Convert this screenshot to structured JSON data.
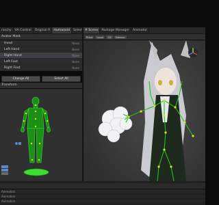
{
  "left_tabs": [
    "rarchy",
    "VA Control",
    "Original R",
    "Humanoid",
    "Selection",
    "Hierarchy"
  ],
  "left_tabs_active": 3,
  "asset_header": "Avatar Mask",
  "mask_rows": [
    {
      "label": "Head",
      "value": "None",
      "selected": false
    },
    {
      "label": "Left Hand",
      "value": "None",
      "selected": false
    },
    {
      "label": "Right Hand",
      "value": "None",
      "selected": true
    },
    {
      "label": "Left Foot",
      "value": "None",
      "selected": false
    },
    {
      "label": "Right Foot",
      "value": "None",
      "selected": false
    }
  ],
  "buttons": {
    "change_all": "Change All",
    "select_all": "Select All"
  },
  "transform_header": "Transform",
  "scene_tabs": [
    "# Scene",
    "Package Manager",
    "Animator"
  ],
  "scene_tools": [
    "Pivot",
    "Local",
    "2D",
    "Gizmos"
  ],
  "timeline_tracks": [
    "Animation",
    "Animation",
    "Animation"
  ],
  "colors": {
    "accent_green": "#22c21a",
    "joint_yellow": "#d8e02a",
    "panel": "#2b2b2b"
  }
}
